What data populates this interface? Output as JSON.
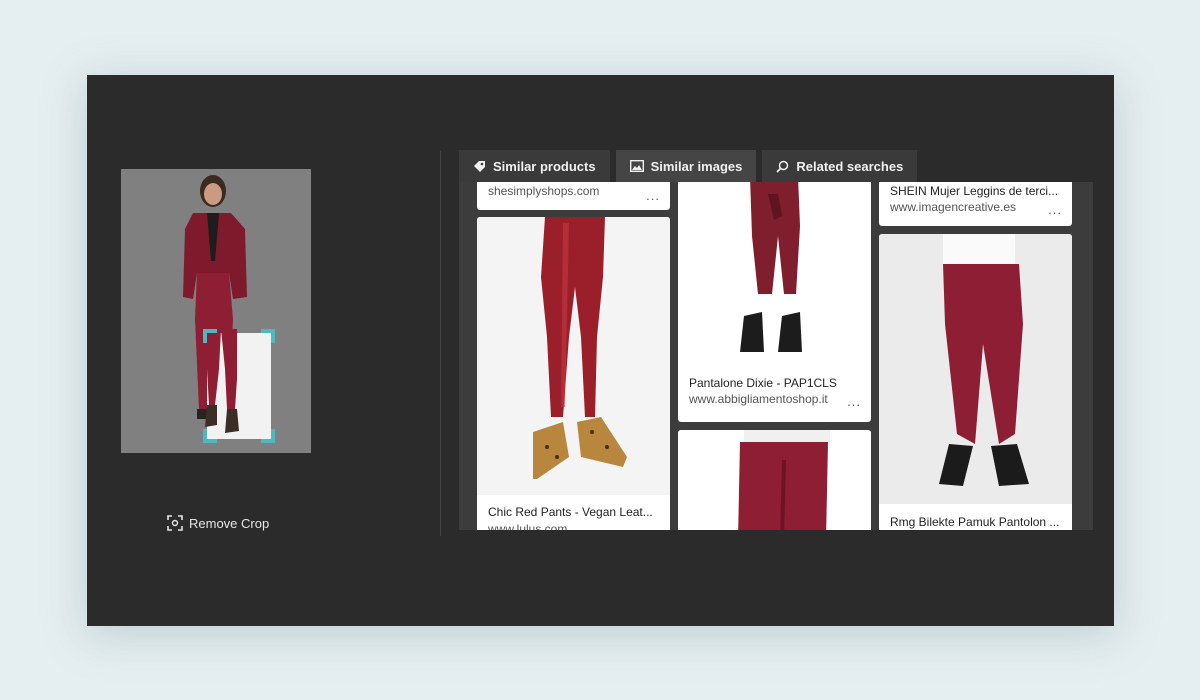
{
  "crop": {
    "remove_label": "Remove Crop"
  },
  "tabs": [
    {
      "label": "Similar products",
      "icon": "tag-icon"
    },
    {
      "label": "Similar images",
      "icon": "image-icon",
      "active": true
    },
    {
      "label": "Related searches",
      "icon": "search-icon"
    }
  ],
  "results": {
    "col1": [
      {
        "title": "",
        "domain": "shesimplyshops.com",
        "more": "..."
      },
      {
        "title": "Chic Red Pants - Vegan Leat...",
        "domain": "www.lulus.com",
        "more": "..."
      }
    ],
    "col2": [
      {
        "title": "Pantalone Dixie - PAP1CLS",
        "domain": "www.abbigliamentoshop.it",
        "more": "..."
      },
      {
        "title": "",
        "domain": "",
        "more": ""
      }
    ],
    "col3": [
      {
        "title": "SHEIN Mujer Leggins de terci...",
        "domain": "www.imagencreative.es",
        "more": "..."
      },
      {
        "title": "Rmg Bilekte Pamuk Pantolon ...",
        "domain": "",
        "more": "..."
      }
    ]
  },
  "colors": {
    "accent": "#4fb8c2",
    "pant_red": "#8e1e33",
    "background": "#2b2b2b"
  }
}
